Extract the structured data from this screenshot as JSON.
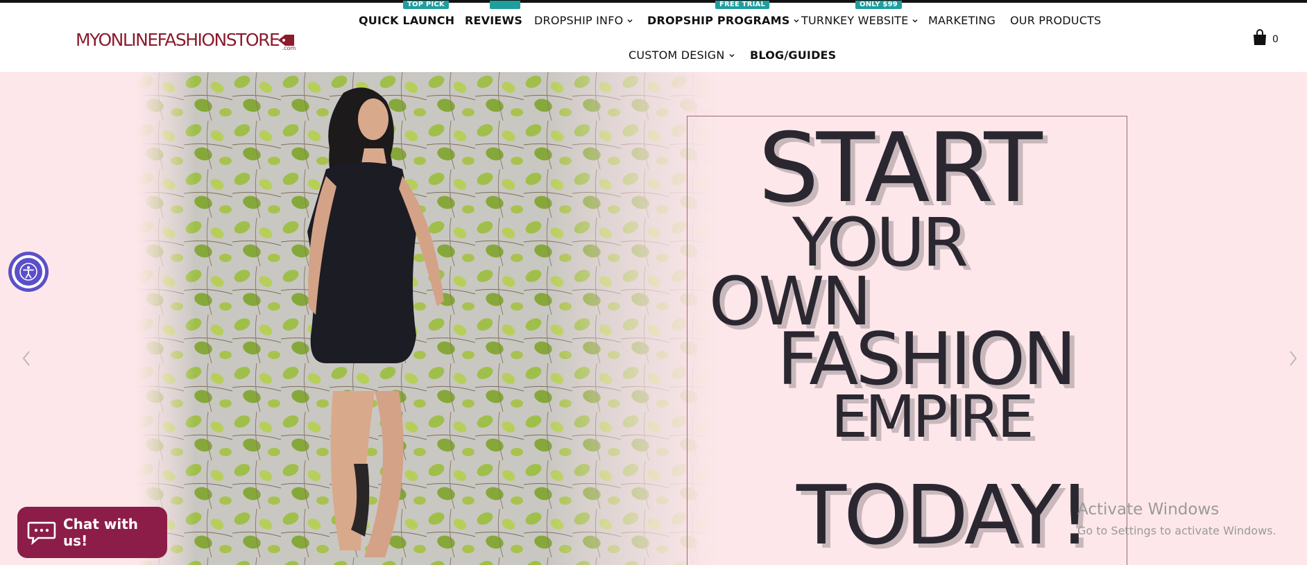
{
  "brand": {
    "logo_text": "MYONLINEFASHIONSTORE",
    "logo_suffix": ".com",
    "color": "#8c1b2e"
  },
  "nav": {
    "row1": [
      {
        "label": "QUICK LAUNCH",
        "bold": true,
        "badge": "TOP PICK",
        "dropdown": false
      },
      {
        "label": "REVIEWS",
        "bold": true,
        "badge": "",
        "dropdown": false
      },
      {
        "label": "DROPSHIP INFO",
        "bold": false,
        "badge": "",
        "dropdown": true
      },
      {
        "label": "DROPSHIP PROGRAMS",
        "bold": true,
        "badge": "FREE TRIAL",
        "dropdown": true
      },
      {
        "label": "TURNKEY WEBSITE",
        "bold": false,
        "badge": "ONLY $99",
        "dropdown": true
      },
      {
        "label": "MARKETING",
        "bold": false,
        "badge": "",
        "dropdown": false
      },
      {
        "label": "OUR PRODUCTS",
        "bold": false,
        "badge": "",
        "dropdown": false
      }
    ],
    "row2": [
      {
        "label": "CUSTOM DESIGN",
        "bold": false,
        "dropdown": true
      },
      {
        "label": "BLOG/GUIDES",
        "bold": true,
        "dropdown": false
      }
    ],
    "badge_color": "#1f9e9e"
  },
  "cart": {
    "icon": "shopping-bag-icon",
    "count": "0"
  },
  "hero": {
    "lines": [
      "START",
      "YOUR",
      "OWN",
      "FASHION",
      "EMPIRE",
      "TODAY!"
    ],
    "background": "#fde7ea"
  },
  "accessibility": {
    "icon": "accessibility-icon",
    "color": "#5b4fc9"
  },
  "chat": {
    "label": "Chat with us!",
    "icon": "chat-bubble-icon",
    "color": "#8c1d48"
  },
  "watermark": {
    "title": "Activate Windows",
    "subtitle": "Go to Settings to activate Windows."
  }
}
